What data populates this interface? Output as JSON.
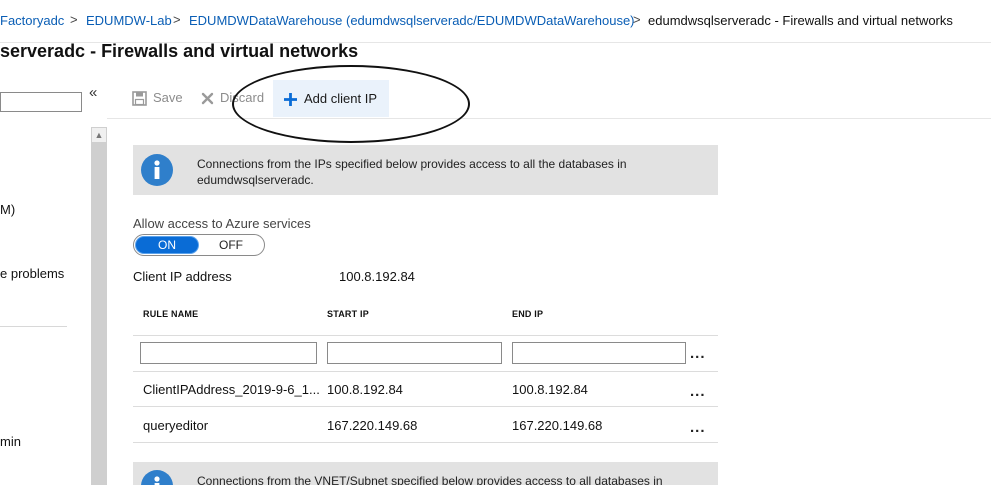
{
  "breadcrumb": {
    "items": [
      "Factoryadc",
      "EDUMDW-Lab",
      "EDUMDWDataWarehouse (edumdwsqlserveradc/EDUMDWDataWarehouse)"
    ],
    "current": "edumdwsqlserveradc - Firewalls and virtual networks",
    "separator": ">"
  },
  "page_title": "serveradc - Firewalls and virtual networks",
  "left_nav": {
    "collapse_glyph": "«",
    "items": [
      "M)",
      "e problems",
      "min"
    ]
  },
  "toolbar": {
    "save_label": "Save",
    "discard_label": "Discard",
    "add_client_ip_label": "Add client IP"
  },
  "info_box": {
    "line1": "Connections from the IPs specified below provides access to all the databases in",
    "line2": "edumdwsqlserveradc."
  },
  "info_box_vnet": {
    "line1": "Connections from the VNET/Subnet specified below provides access to all databases in"
  },
  "azure_access": {
    "label": "Allow access to Azure services",
    "on_label": "ON",
    "off_label": "OFF",
    "selected": "ON"
  },
  "client_ip": {
    "label": "Client IP address",
    "value": "100.8.192.84"
  },
  "rules_table": {
    "headers": [
      "RULE NAME",
      "START IP",
      "END IP"
    ],
    "more_glyph": "...",
    "rows": [
      {
        "name": "ClientIPAddress_2019-9-6_1...",
        "start": "100.8.192.84",
        "end": "100.8.192.84"
      },
      {
        "name": "queryeditor",
        "start": "167.220.149.68",
        "end": "167.220.149.68"
      }
    ]
  },
  "colors": {
    "link": "#0a5eb5",
    "accent": "#0a6cd6",
    "info_icon": "#2f7fcb",
    "info_bg": "#e2e2e2",
    "toolbar_active_bg": "#eaf2fb"
  },
  "icons": [
    "save-icon",
    "discard-icon",
    "plus-icon",
    "info-icon",
    "more-icon"
  ]
}
